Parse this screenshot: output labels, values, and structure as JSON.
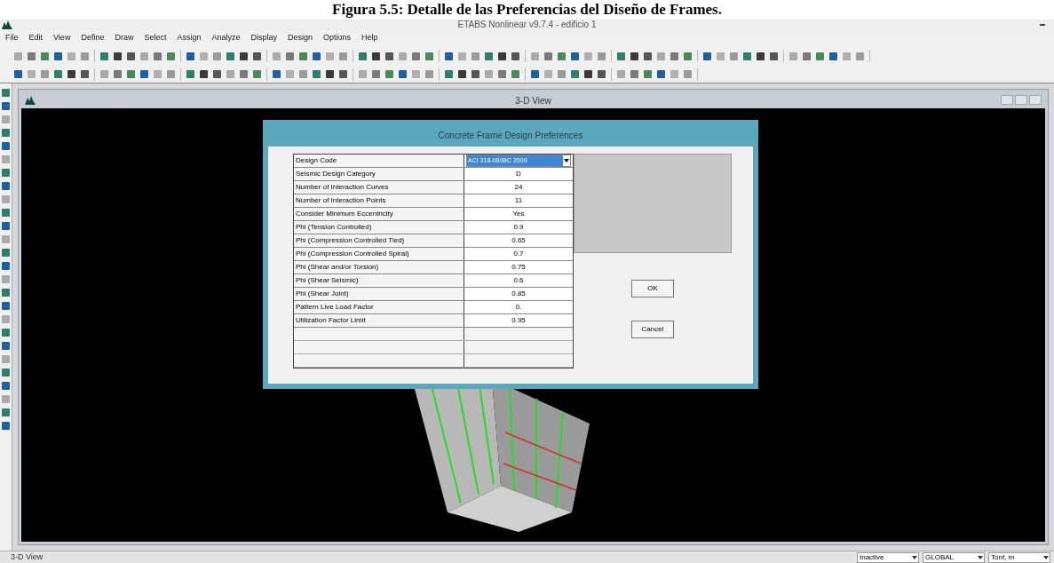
{
  "caption": "Figura 5.5: Detalle de las Preferencias del Diseño de Frames.",
  "window": {
    "title": "ETABS Nonlinear v9.7.4 - edificio 1"
  },
  "menu": [
    "File",
    "Edit",
    "View",
    "Define",
    "Draw",
    "Select",
    "Assign",
    "Analyze",
    "Display",
    "Design",
    "Options",
    "Help"
  ],
  "view_window": {
    "title": "3-D View"
  },
  "dialog": {
    "title": "Concrete Frame Design Preferences",
    "rows": [
      {
        "label": "Design Code",
        "value": "ACI 318-08/IBC 2009",
        "kind": "dropdown"
      },
      {
        "label": "Seismic Design Category",
        "value": "D",
        "kind": "text"
      },
      {
        "label": "Number of Interaction Curves",
        "value": "24",
        "kind": "text"
      },
      {
        "label": "Number of Interaction Points",
        "value": "11",
        "kind": "text"
      },
      {
        "label": "Consider Minimum Eccentricity",
        "value": "Yes",
        "kind": "text"
      },
      {
        "label": "Phi (Tension Controlled)",
        "value": "0.9",
        "kind": "text"
      },
      {
        "label": "Phi (Compression Controlled Tied)",
        "value": "0.65",
        "kind": "text"
      },
      {
        "label": "Phi (Compression Controlled Spiral)",
        "value": "0.7",
        "kind": "text"
      },
      {
        "label": "Phi (Shear and/or Torsion)",
        "value": "0.75",
        "kind": "text"
      },
      {
        "label": "Phi (Shear Seismic)",
        "value": "0.6",
        "kind": "text"
      },
      {
        "label": "Phi (Shear Joint)",
        "value": "0.85",
        "kind": "text"
      },
      {
        "label": "Pattern Live Load Factor",
        "value": "0.",
        "kind": "text"
      },
      {
        "label": "Utilization Factor Limit",
        "value": "0.95",
        "kind": "text"
      }
    ],
    "buttons": [
      "OK",
      "Cancel"
    ]
  },
  "status_bar": {
    "text": "3-D View",
    "dropdowns": [
      "Inactive",
      "GLOBAL",
      "Tonf, m"
    ]
  }
}
